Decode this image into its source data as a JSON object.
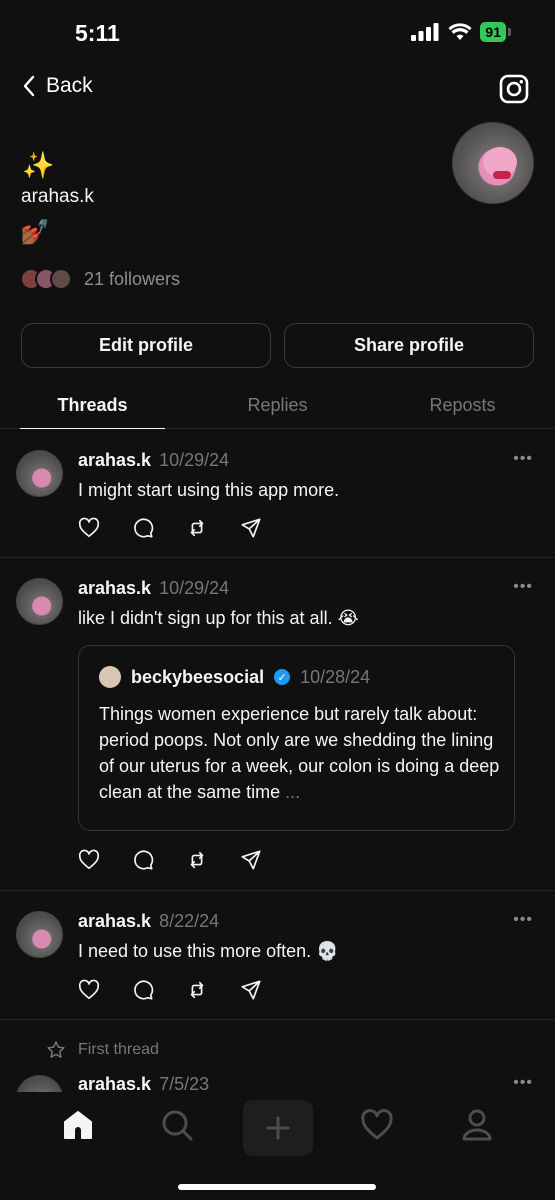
{
  "status_bar": {
    "time": "5:11",
    "battery": "91"
  },
  "header": {
    "back_label": "Back",
    "instagram_icon": "instagram-icon"
  },
  "profile": {
    "emoji_top": "✨",
    "username": "arahas.k",
    "emoji_bottom": "💅🏾",
    "followers_label": "21 followers"
  },
  "buttons": {
    "edit": "Edit profile",
    "share": "Share profile"
  },
  "tabs": [
    {
      "label": "Threads",
      "active": true
    },
    {
      "label": "Replies",
      "active": false
    },
    {
      "label": "Reposts",
      "active": false
    }
  ],
  "posts": [
    {
      "user": "arahas.k",
      "date": "10/29/24",
      "text": "I might start using this app more."
    },
    {
      "user": "arahas.k",
      "date": "10/29/24",
      "text": "like I didn't sign up for this at all. 😭",
      "quote": {
        "user": "beckybeesocial",
        "date": "10/28/24",
        "text": "Things women experience but rarely talk about: period poops. Not only are we shedding the lining of our uterus for a week, our colon is doing a deep clean at the same time",
        "ellipsis": "..."
      }
    },
    {
      "user": "arahas.k",
      "date": "8/22/24",
      "text": "I need to use this more often. 💀"
    },
    {
      "user": "arahas.k",
      "date": "7/5/23",
      "text": ""
    }
  ],
  "more_label": "•••",
  "first_thread_label": "First thread",
  "colors": {
    "background": "#101010",
    "text": "#f3f5f7",
    "muted": "#777777",
    "verified": "#1d9bf0",
    "battery": "#34c759"
  }
}
